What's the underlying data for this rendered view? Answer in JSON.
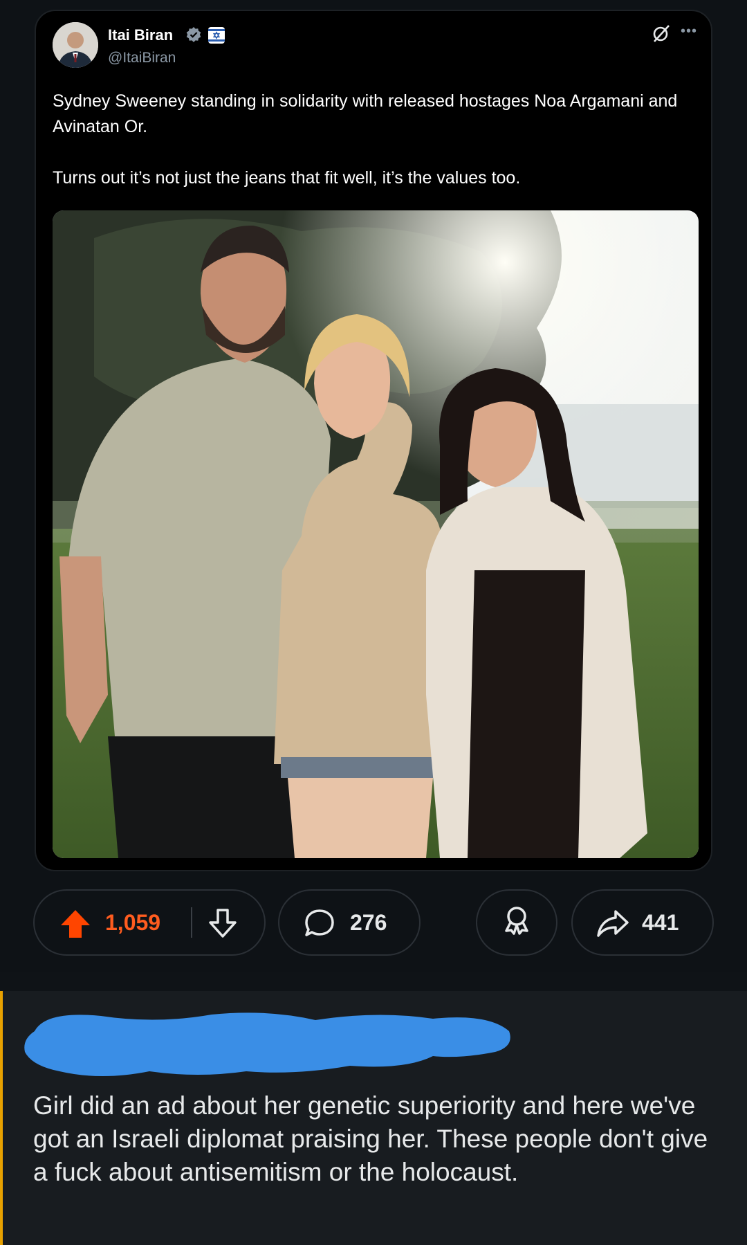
{
  "tweet": {
    "author_name": "Itai Biran",
    "author_handle": "@ItaiBiran",
    "icons": [
      "verified-badge-icon",
      "israel-flag-icon",
      "grok-icon",
      "more-icon"
    ],
    "paragraphs": [
      "Sydney Sweeney standing in solidarity with released hostages Noa Argamani and Avinatan Or.",
      "Turns out it’s not just the jeans that fit well, it’s the values too."
    ]
  },
  "actions": {
    "upvotes": "1,059",
    "comments": "276",
    "shares": "441",
    "upvote_color": "#ff4500"
  },
  "comment": {
    "text": "Girl did an ad about her genetic superiority and here we've got an Israeli diplomat praising her. These people don't give a fuck about antisemitism or the holocaust.",
    "redaction_color": "#3a8ee6",
    "thread_color": "#e8a100"
  }
}
